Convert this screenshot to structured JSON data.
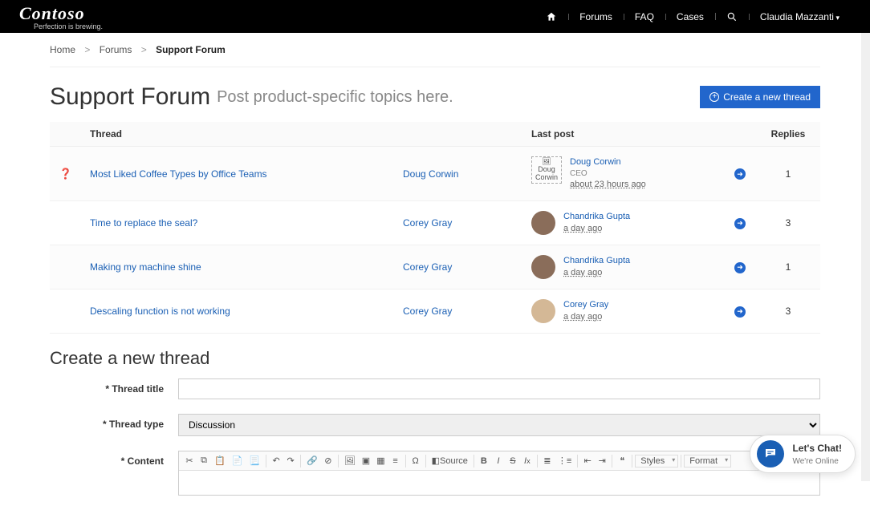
{
  "nav": {
    "brand": "Contoso",
    "tagline": "Perfection is brewing.",
    "items": {
      "forums": "Forums",
      "faq": "FAQ",
      "cases": "Cases"
    },
    "user": "Claudia Mazzanti"
  },
  "breadcrumb": {
    "home": "Home",
    "forums": "Forums",
    "current": "Support Forum"
  },
  "page": {
    "title": "Support Forum",
    "subtitle": "Post product-specific topics here.",
    "create_btn": "Create a new thread"
  },
  "table": {
    "headers": {
      "thread": "Thread",
      "lastpost": "Last post",
      "replies": "Replies"
    },
    "rows": [
      {
        "title": "Most Liked Coffee Types by Office Teams",
        "author": "Doug Corwin",
        "has_q": true,
        "lp_name": "Doug Corwin",
        "lp_role": "CEO",
        "lp_time": "about 23 hours ago",
        "avatar_broken": true,
        "avatar_alt": "Doug Corwin",
        "replies": "1"
      },
      {
        "title": "Time to replace the seal?",
        "author": "Corey Gray",
        "has_q": false,
        "lp_name": "Chandrika Gupta",
        "lp_role": "",
        "lp_time": "a day ago",
        "avatar_broken": false,
        "avatar_alt": "",
        "replies": "3"
      },
      {
        "title": "Making my machine shine",
        "author": "Corey Gray",
        "has_q": false,
        "lp_name": "Chandrika Gupta",
        "lp_role": "",
        "lp_time": "a day ago",
        "avatar_broken": false,
        "avatar_alt": "",
        "replies": "1"
      },
      {
        "title": "Descaling function is not working",
        "author": "Corey Gray",
        "has_q": false,
        "lp_name": "Corey Gray",
        "lp_role": "",
        "lp_time": "a day ago",
        "avatar_broken": false,
        "avatar_male": true,
        "avatar_alt": "",
        "replies": "3"
      }
    ]
  },
  "form": {
    "heading": "Create a new thread",
    "labels": {
      "title": "* Thread title",
      "type": "* Thread type",
      "content": "* Content"
    },
    "type_value": "Discussion",
    "toolbar": {
      "source": "Source",
      "styles": "Styles",
      "format": "Format"
    }
  },
  "chat": {
    "title": "Let's Chat!",
    "status": "We're Online"
  }
}
